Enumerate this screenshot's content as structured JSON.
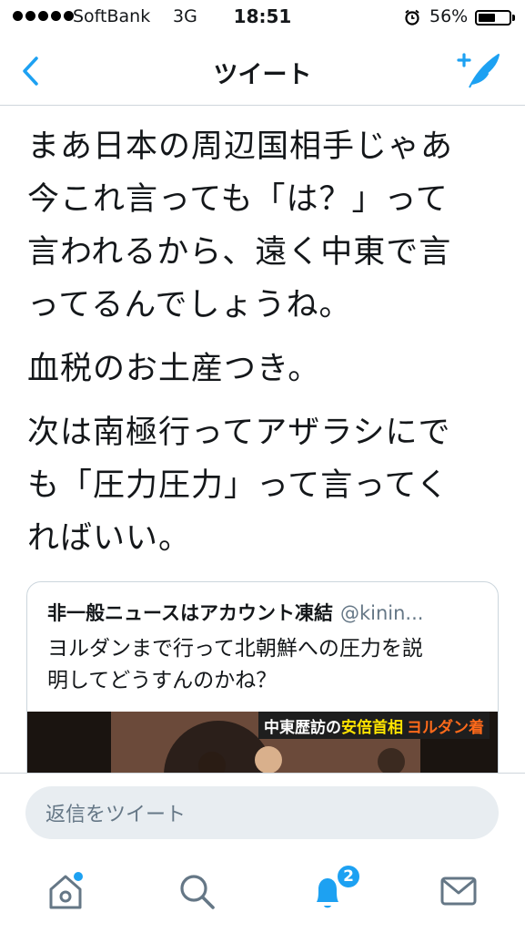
{
  "status_bar": {
    "carrier": "SoftBank",
    "network": "3G",
    "time": "18:51",
    "battery_percent": "56%",
    "battery_level": 0.56,
    "icons": [
      "signal-dots-icon",
      "alarm-icon",
      "battery-icon"
    ]
  },
  "nav": {
    "title": "ツイート",
    "back_icon": "chevron-left-icon",
    "compose_icon": "compose-tweet-icon",
    "accent_color": "#1da1f2"
  },
  "tweet": {
    "paragraphs": [
      "まあ日本の周辺国相手じゃあ\n今これ言っても「は？」って\n言われるから、遠く中東で言\nってるんでしょうね。",
      "血税のお土産つき。",
      "次は南極行ってアザラシにで\nも「圧力圧力」って言ってく\nればいい。"
    ]
  },
  "quoted_tweet": {
    "name": "非一般ニュースはアカウント凍結",
    "handle": "@kinin...",
    "text": "ヨルダンまで行って北朝鮮への圧力を説\n明してどうすんのかね？",
    "media_banner": {
      "part1": "中東歴訪の",
      "part2": "安倍首相",
      "part3": "ヨルダン着"
    }
  },
  "reply": {
    "placeholder": "返信をツイート"
  },
  "tab_bar": {
    "tabs": [
      "home-icon",
      "search-icon",
      "notifications-icon",
      "messages-icon"
    ],
    "notification_count": "2"
  }
}
